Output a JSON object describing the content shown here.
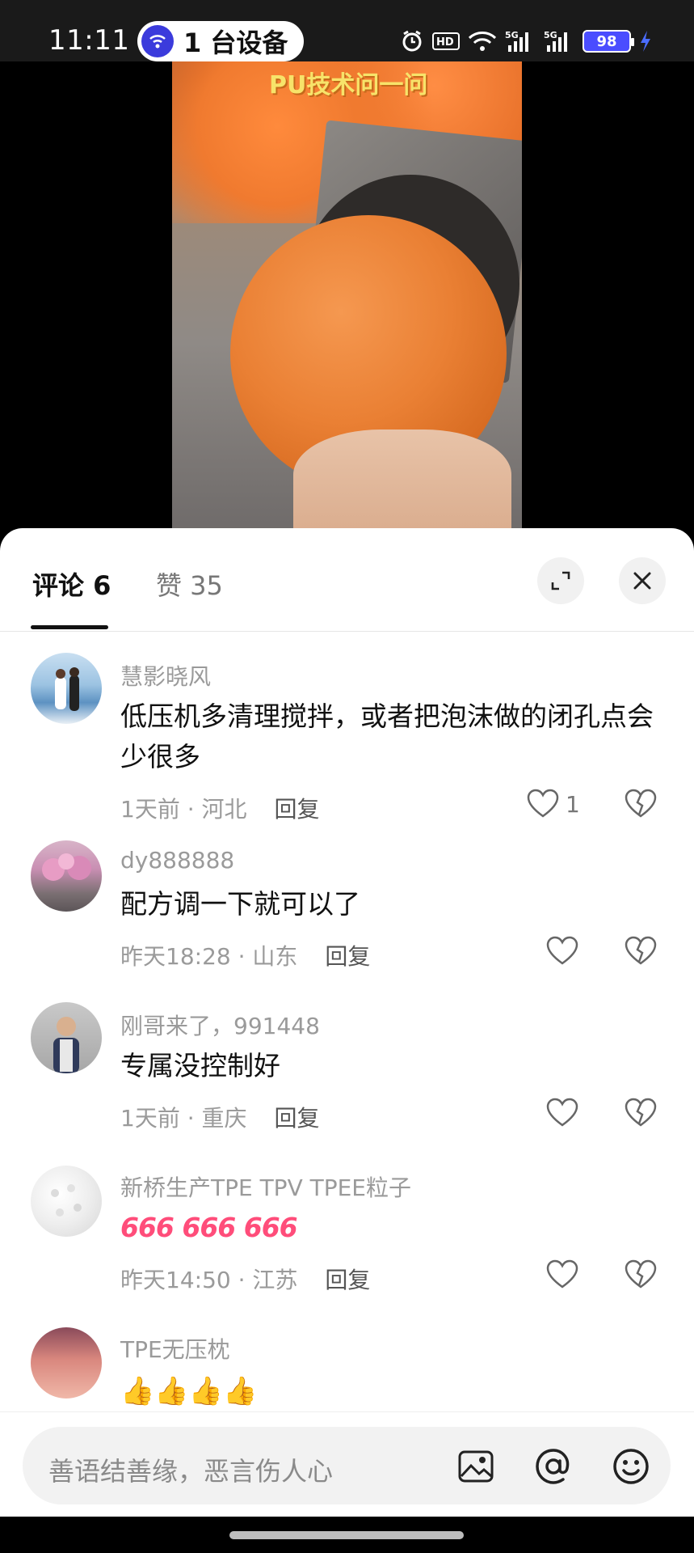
{
  "status_bar": {
    "time": "11:11",
    "device_pill": "1 台设备",
    "battery": "98",
    "icons": [
      "alarm-icon",
      "hd-icon",
      "wifi-icon",
      "signal-5g-icon",
      "signal-5g-icon",
      "battery-icon",
      "charging-icon"
    ]
  },
  "video": {
    "caption": "PU技术问一问"
  },
  "sheet": {
    "tab_comments": "评论 6",
    "tab_likes": "赞 35",
    "expand_icon": "expand-icon",
    "close_icon": "close-icon"
  },
  "comments": [
    {
      "name": "慧影晓风",
      "text": "低压机多清理搅拌，或者把泡沫做的闭孔点会少很多",
      "meta": "1天前 · 河北",
      "reply": "回复",
      "likes": "1"
    },
    {
      "name": "dy888888",
      "text": "配方调一下就可以了",
      "meta": "昨天18:28 · 山东",
      "reply": "回复",
      "likes": ""
    },
    {
      "name": "刚哥来了，991448",
      "text": "专属没控制好",
      "meta": "1天前 · 重庆",
      "reply": "回复",
      "likes": ""
    },
    {
      "name": "新桥生产TPE  TPV  TPEE粒子",
      "text": "666 666 666",
      "meta": "昨天14:50 · 江苏",
      "reply": "回复",
      "likes": ""
    },
    {
      "name": "TPE无压枕",
      "text": "👍👍👍👍",
      "meta": "",
      "reply": "",
      "likes": ""
    }
  ],
  "input": {
    "placeholder": "善语结善缘，恶言伤人心",
    "icons": [
      "image-icon",
      "at-icon",
      "emoji-icon"
    ]
  },
  "colors": {
    "accent_battery": "#4a4dff",
    "pill_icon": "#3b3bdc",
    "emoji_pink": "#ff4d7a"
  }
}
